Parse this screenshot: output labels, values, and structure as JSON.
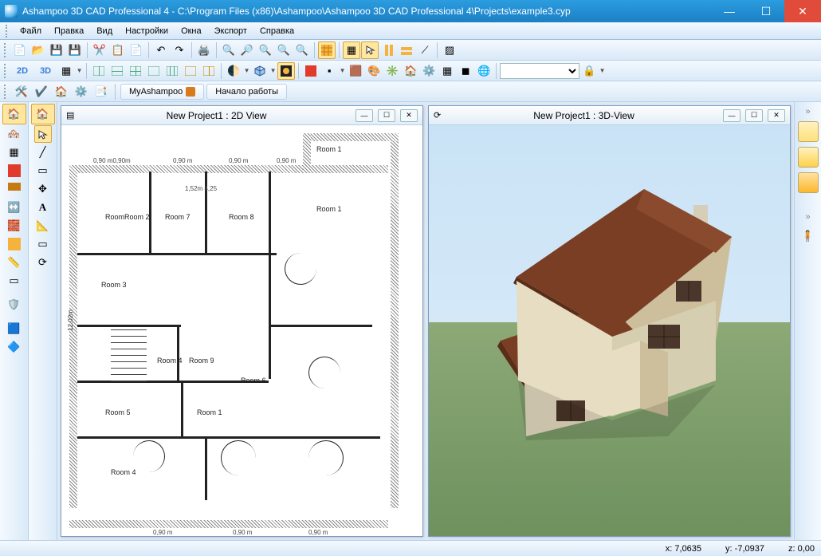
{
  "title": "Ashampoo 3D CAD Professional 4 - C:\\Program Files (x86)\\Ashampoo\\Ashampoo 3D CAD Professional 4\\Projects\\example3.cyp",
  "menu": [
    "Файл",
    "Правка",
    "Вид",
    "Настройки",
    "Окна",
    "Экспорт",
    "Справка"
  ],
  "tabs": {
    "my": "MyAshampoo",
    "start": "Начало работы"
  },
  "views": {
    "v2d_title": "New Project1 : 2D View",
    "v3d_title": "New Project1 : 3D-View"
  },
  "view_mode": {
    "m2d": "2D",
    "m3d": "3D"
  },
  "rooms": {
    "r1": "Room 1",
    "r1b": "Room 1",
    "r2": "RoomRoom 2",
    "r3": "Room 3",
    "r4": "Room 4",
    "r4b": "Room 4",
    "r5": "Room 5",
    "r6": "Room 6",
    "r7": "Room 7",
    "r8": "Room 8",
    "r9": "Room 9",
    "r1c": "Room 1"
  },
  "dims": {
    "top1": "0,90 m",
    "top2": "0,90 m",
    "top3": "0,90 m",
    "top4": "0,90 m",
    "top5": "0,90 m",
    "pref": "0,90 m0,90m",
    "side": "12,02m",
    "mid": "1,52m 4,25"
  },
  "status": {
    "x": "x: 7,0635",
    "y": "y: -7,0937",
    "z": "z: 0,00"
  }
}
